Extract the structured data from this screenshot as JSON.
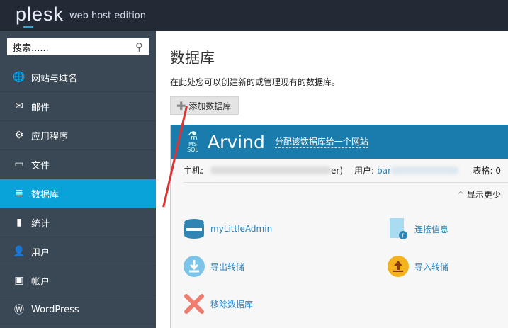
{
  "header": {
    "logo": "plesk",
    "edition": "web host edition"
  },
  "sidebar": {
    "search_placeholder": "搜索......",
    "items": [
      {
        "label": "网站与域名",
        "icon": "globe-icon",
        "glyph": "🌐"
      },
      {
        "label": "邮件",
        "icon": "mail-icon",
        "glyph": "✉"
      },
      {
        "label": "应用程序",
        "icon": "gear-icon",
        "glyph": "⚙"
      },
      {
        "label": "文件",
        "icon": "folder-icon",
        "glyph": "▭"
      },
      {
        "label": "数据库",
        "icon": "database-icon",
        "glyph": "≣",
        "active": true
      },
      {
        "label": "统计",
        "icon": "stats-icon",
        "glyph": "▮"
      },
      {
        "label": "用户",
        "icon": "user-icon",
        "glyph": "👤"
      },
      {
        "label": "帐户",
        "icon": "account-icon",
        "glyph": "▣"
      },
      {
        "label": "WordPress",
        "icon": "wordpress-icon",
        "glyph": "Ⓦ"
      }
    ]
  },
  "main": {
    "title": "数据库",
    "description": "在此处您可以创建新的或管理现有的数据库。",
    "add_button": "添加数据库",
    "db": {
      "type": "MS SQL",
      "name": "Arvind",
      "assign": "分配该数据库给一个网站",
      "host_label": "主机:",
      "host_tail": "er)",
      "user_label": "用户:",
      "user_value": "bar",
      "tables": "表格: 0",
      "show_less": "显示更少",
      "actions": [
        "myLittleAdmin",
        "连接信息",
        "导出转储",
        "导入转储",
        "移除数据库"
      ]
    }
  },
  "colors": {
    "active": "#0aa3d9",
    "panel_header": "#1a7bad",
    "link": "#2a80b9"
  }
}
